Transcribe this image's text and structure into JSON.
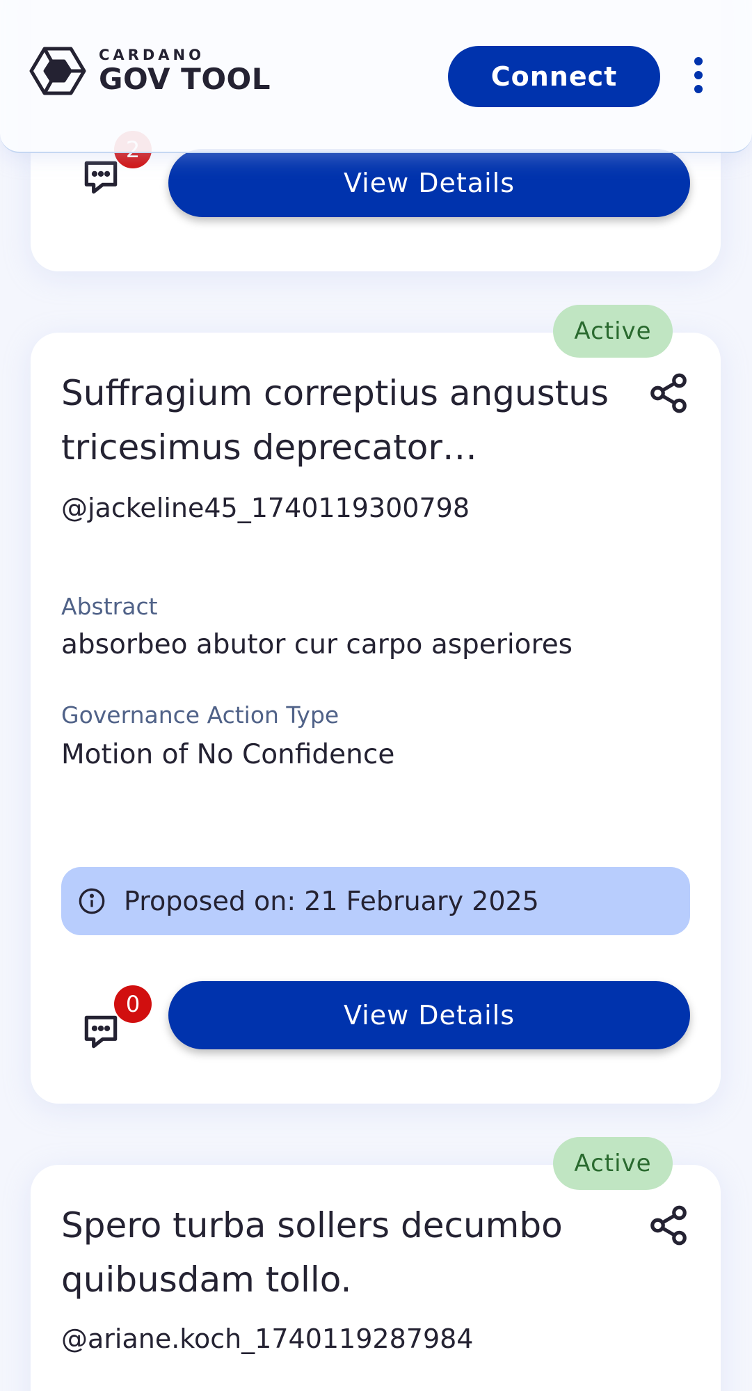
{
  "header": {
    "logo_small": "CARDANO",
    "logo_big": "GOV TOOL",
    "connect_label": "Connect"
  },
  "cards": [
    {
      "comment_count": "2",
      "view_label": "View Details"
    },
    {
      "status": "Active",
      "title": "Suffragium correptius angustus tricesimus deprecator…",
      "author": "@jackeline45_1740119300798",
      "abstract_label": "Abstract",
      "abstract": "absorbeo abutor cur carpo asperiores",
      "type_label": "Governance Action Type",
      "type": "Motion of No Confidence",
      "proposed": "Proposed on: 21 February 2025",
      "comment_count": "0",
      "view_label": "View Details"
    },
    {
      "status": "Active",
      "title": "Spero turba sollers decumbo quibusdam tollo.",
      "author": "@ariane.koch_1740119287984"
    }
  ],
  "colors": {
    "primary": "#0033ad",
    "badge_active_bg": "#c0e5c2",
    "badge_active_fg": "#2a6a2f",
    "proposed_bg": "#b8cdfd",
    "count_badge": "#d10f0f"
  }
}
